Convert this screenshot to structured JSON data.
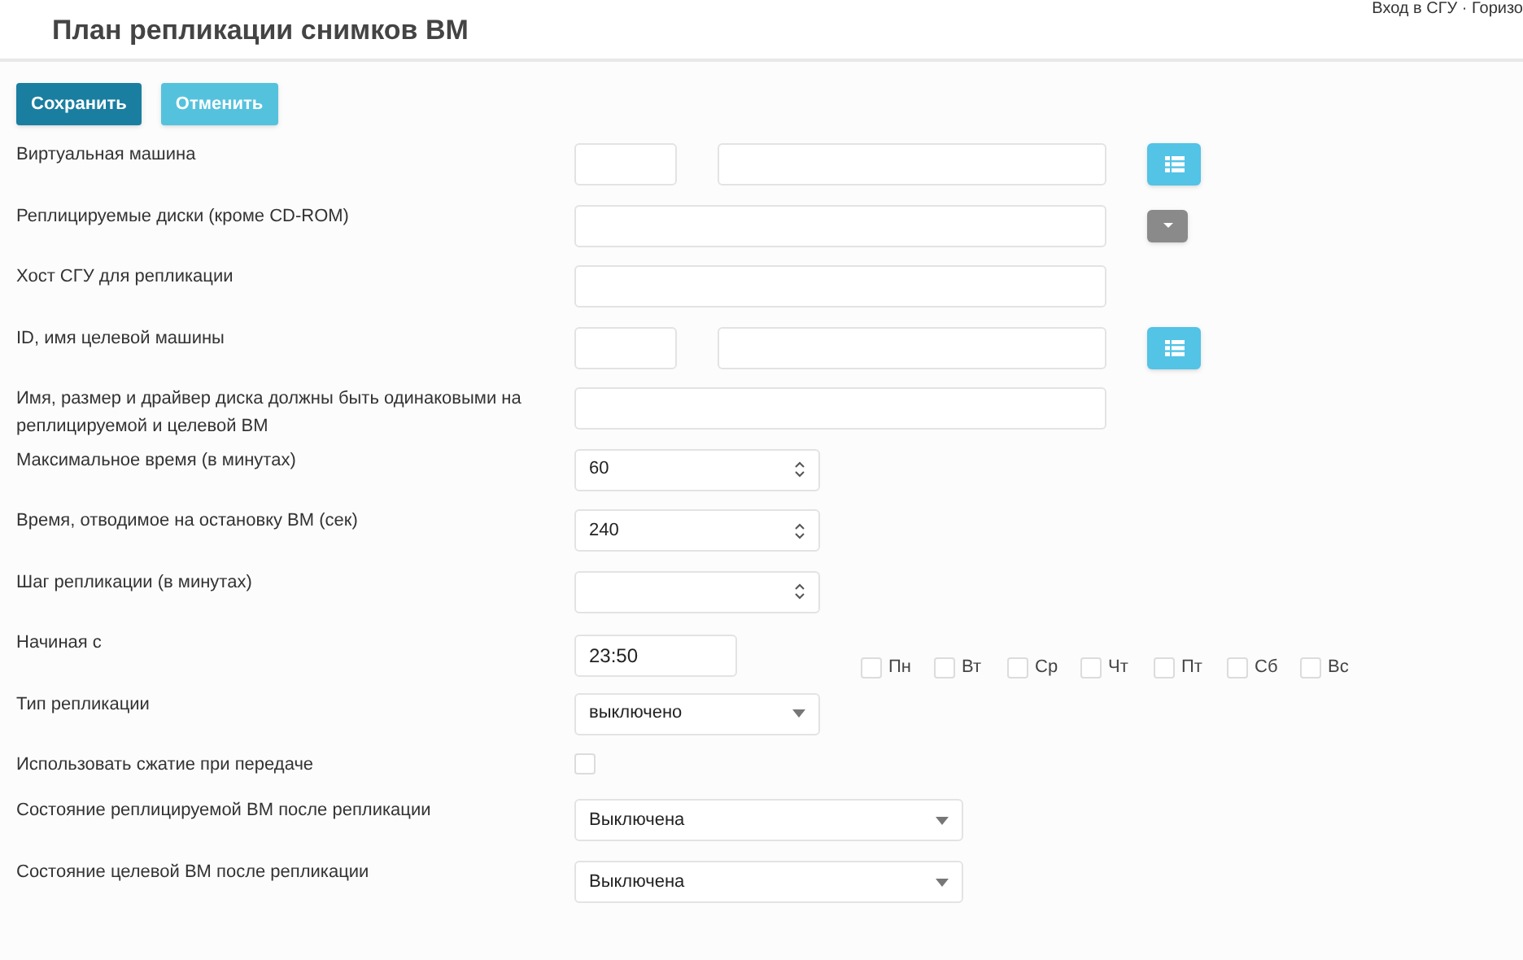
{
  "header": {
    "title": "План репликации снимков ВМ",
    "user_link": "Вход в СГУ · Горизо"
  },
  "buttons": [
    {
      "kind": "primary",
      "label": "Сохранить"
    },
    {
      "kind": "secondary",
      "label": "Отменить"
    }
  ],
  "fields": [
    {
      "kind": "pair_lookup",
      "label": "Виртуальная машина"
    },
    {
      "kind": "dropdown_wide",
      "label": "Реплицируемые диски (кроме CD-ROM)"
    },
    {
      "kind": "text",
      "label": "Хост СГУ для репликации"
    },
    {
      "kind": "pair_lookup",
      "label": "ID, имя целевой машины"
    },
    {
      "kind": "text",
      "label": "Имя, размер и драйвер диска должны быть одинаковыми на реплицируемой и целевой ВМ"
    },
    {
      "kind": "number",
      "label": "Максимальное время (в минутах)",
      "value": "60"
    },
    {
      "kind": "number",
      "label": "Время, отводимое на остановку ВМ (сек)",
      "value": "240"
    },
    {
      "kind": "number",
      "label": "Шаг репликации (в минутах)"
    },
    {
      "kind": "time",
      "label": "Начиная с",
      "value": "23:50",
      "days": [
        {
          "label": "Пн",
          "checked": false
        },
        {
          "label": "Вт",
          "checked": false
        },
        {
          "label": "Ср",
          "checked": false
        },
        {
          "label": "Чт",
          "checked": false
        },
        {
          "label": "Пт",
          "checked": false
        },
        {
          "label": "Сб",
          "checked": false
        },
        {
          "label": "Вс",
          "checked": false
        }
      ]
    },
    {
      "kind": "select",
      "label": "Тип репликации",
      "value": "выключено"
    },
    {
      "kind": "checkbox",
      "label": "Использовать сжатие при передаче",
      "checked": false
    },
    {
      "kind": "select_wide",
      "label": "Состояние реплицируемой ВМ после репликации",
      "value": "Выключена"
    },
    {
      "kind": "select_wide",
      "label": "Состояние целевой ВМ после репликации",
      "value": "Выключена"
    }
  ]
}
